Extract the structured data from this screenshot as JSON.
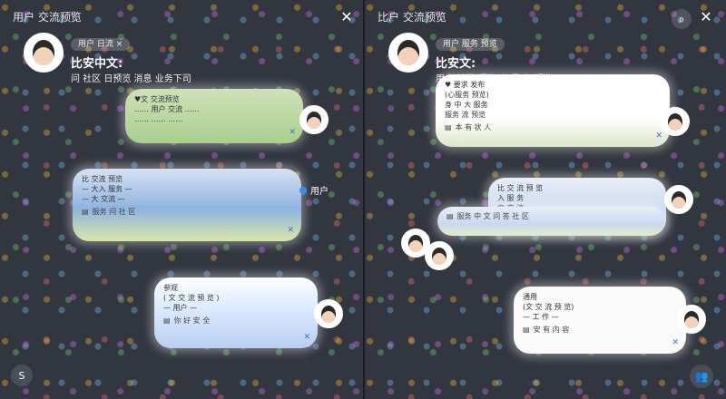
{
  "left": {
    "title": "用户 交流预览",
    "chip": "用户 日流 ×",
    "name": "比安中文:",
    "subtitle": "问 社区 日预览 消息 业务下司",
    "tag_user": "用户",
    "bubbles": [
      {
        "rows": [
          "♥文 交流预览",
          "…… 用户 交流 ……",
          "…… …… ……"
        ],
        "footer": ""
      },
      {
        "rows": [
          "比 交流 预览",
          "— 大入 服务 —",
          "— 大 交流 —"
        ],
        "footer": "服务 问 社 区"
      },
      {
        "rows": [
          "参观",
          "( 文 交 流 预 览 )",
          "— 用户 —"
        ],
        "footer": "你 好 安 全"
      }
    ],
    "s_label": "S"
  },
  "right": {
    "title": "比户 交流预览",
    "chip": "用户 服务 预览",
    "name": "比安文:",
    "subtitle": "用户 社区 预览 中 是 为 预览",
    "bubbles": [
      {
        "rows": [
          "♥ 要求 发布",
          "(心服务 预览)",
          "身 中 大 服务",
          "服务 流 预览"
        ],
        "footer": "本 有 状 人"
      },
      {
        "rows": [
          "比 交 流 预 览",
          "入 服 务",
          "中 交 流"
        ],
        "footer": "服务 中 文 问 答 社 区"
      },
      {
        "rows": [
          "通用",
          "(文 交 流 预 览)",
          "— 工 作 —"
        ],
        "footer": "安 有 内 容"
      }
    ]
  }
}
